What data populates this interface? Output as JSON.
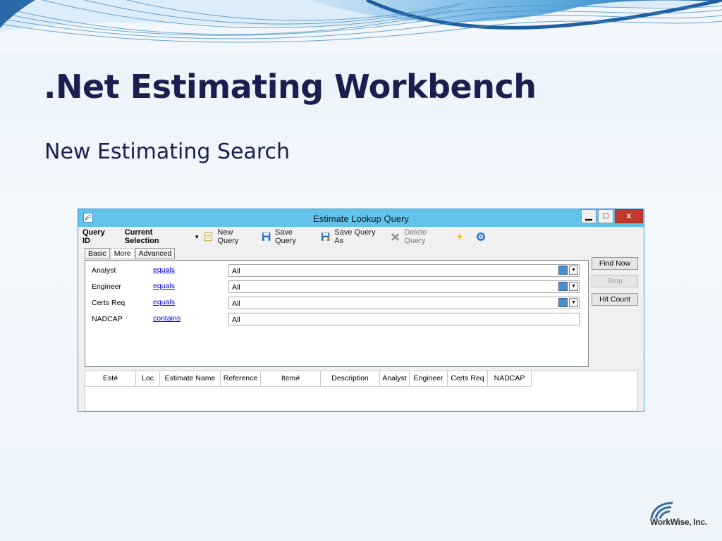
{
  "slide": {
    "title": ".Net Estimating Workbench",
    "subtitle": "New Estimating Search",
    "logo_text": "WorkWise, Inc."
  },
  "window": {
    "title": "Estimate Lookup Query",
    "min_label": "▁",
    "max_label": "□",
    "close_label": "x"
  },
  "toolbar": {
    "query_id_label": "Query ID",
    "current_selection": "Current Selection",
    "new_query": "New Query",
    "save_query": "Save Query",
    "save_query_as": "Save Query As",
    "delete_query": "Delete Query"
  },
  "tabs": [
    {
      "label": "Basic",
      "active": false
    },
    {
      "label": "More",
      "active": true
    },
    {
      "label": "Advanced",
      "active": false
    }
  ],
  "criteria": [
    {
      "field": "Analyst",
      "operator": "equals",
      "value": "All",
      "has_picker": true
    },
    {
      "field": "Engineer",
      "operator": "equals",
      "value": "All",
      "has_picker": true
    },
    {
      "field": "Certs Req",
      "operator": "equals",
      "value": "All",
      "has_picker": true
    },
    {
      "field": "NADCAP",
      "operator": "contains",
      "value": "All",
      "has_picker": false
    }
  ],
  "buttons": {
    "find_now": "Find Now",
    "stop": "Stop",
    "hit_count": "Hit Count"
  },
  "columns": [
    "Est#",
    "Loc",
    "Estimate Name",
    "Reference",
    "Item#",
    "Description",
    "Analyst",
    "Engineer",
    "Certs Req",
    "NADCAP"
  ],
  "colors": {
    "title": "#1b1f4f",
    "titlebar": "#61c2ea",
    "close": "#c0392b",
    "link": "#0000ee"
  },
  "icons": [
    "app-icon",
    "dropdown-arrow-icon",
    "new-query-icon",
    "save-icon",
    "save-as-icon",
    "delete-icon",
    "lightning-icon",
    "help-icon",
    "grid-picker-icon",
    "chevron-down-icon"
  ]
}
